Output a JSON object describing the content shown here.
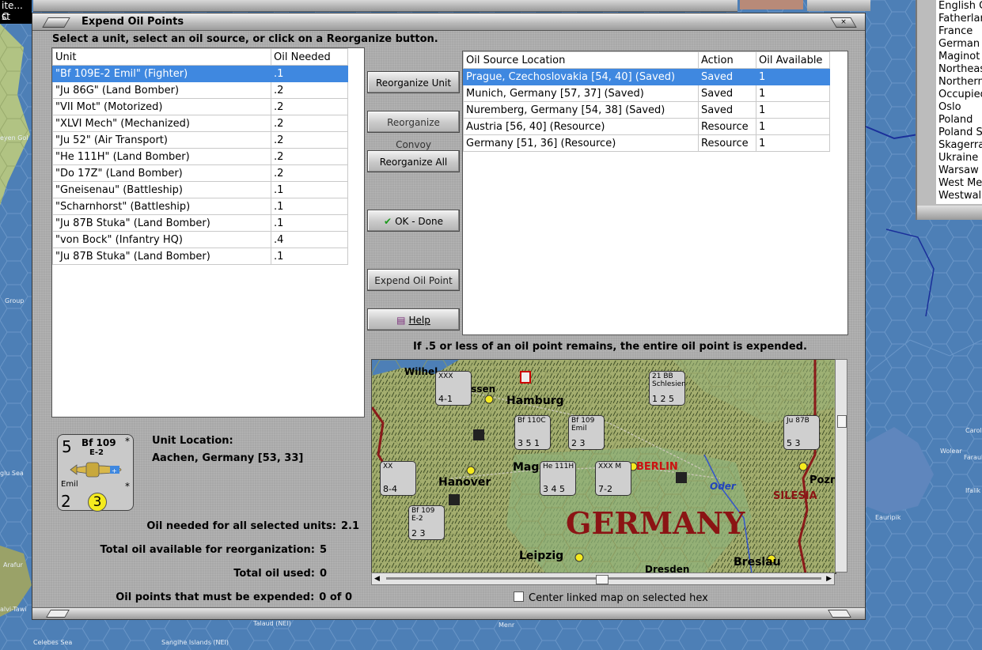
{
  "window": {
    "title": "Expend Oil Points",
    "close_glyph": "×",
    "instructions": "Select a unit, select an oil source, or click on a Reorganize button."
  },
  "units_table": {
    "columns": [
      "Unit",
      "Oil Needed"
    ],
    "rows": [
      {
        "unit": "\"Bf 109E-2 Emil\" (Fighter)",
        "oil": ".1",
        "selected": true
      },
      {
        "unit": "\"Ju 86G\" (Land Bomber)",
        "oil": ".2"
      },
      {
        "unit": "\"VII Mot\" (Motorized)",
        "oil": ".2"
      },
      {
        "unit": "\"XLVI Mech\" (Mechanized)",
        "oil": ".2"
      },
      {
        "unit": "\"Ju 52\" (Air Transport)",
        "oil": ".2"
      },
      {
        "unit": "\"He 111H\" (Land Bomber)",
        "oil": ".2"
      },
      {
        "unit": "\"Do 17Z\" (Land Bomber)",
        "oil": ".2"
      },
      {
        "unit": "\"Gneisenau\" (Battleship)",
        "oil": ".1"
      },
      {
        "unit": "\"Scharnhorst\" (Battleship)",
        "oil": ".1"
      },
      {
        "unit": "\"Ju 87B Stuka\" (Land Bomber)",
        "oil": ".1"
      },
      {
        "unit": "\"von Bock\" (Infantry HQ)",
        "oil": ".4"
      },
      {
        "unit": "\"Ju 87B Stuka\" (Land Bomber)",
        "oil": ".1"
      }
    ]
  },
  "oil_table": {
    "columns": [
      "Oil Source Location",
      "Action",
      "Oil Available"
    ],
    "rows": [
      {
        "location": "Prague, Czechoslovakia [54, 40] (Saved)",
        "action": "Saved",
        "available": "1",
        "selected": true
      },
      {
        "location": "Munich, Germany [57, 37] (Saved)",
        "action": "Saved",
        "available": "1"
      },
      {
        "location": "Nuremberg, Germany [54, 38] (Saved)",
        "action": "Saved",
        "available": "1"
      },
      {
        "location": "Austria [56, 40] (Resource)",
        "action": "Resource",
        "available": "1"
      },
      {
        "location": "Germany [51, 36] (Resource)",
        "action": "Resource",
        "available": "1"
      }
    ]
  },
  "buttons": {
    "reorganize_unit": "Reorganize Unit",
    "reorganize_convoy": "Reorganize Convoy",
    "reorganize_all": "Reorganize All",
    "ok_done": "OK - Done",
    "expend_oil_point": "Expend Oil Point",
    "help": "Help"
  },
  "icons": {
    "ok": "check-icon",
    "help": "book-icon",
    "close": "close-icon"
  },
  "expend_note": "If .5 or less of an oil point remains, the entire oil point is expended.",
  "selected_unit": {
    "attack": "5",
    "name": "Bf 109",
    "variant": "E-2",
    "nickname": "Emil",
    "defense": "2",
    "range": "3",
    "location_label": "Unit Location:",
    "location_value": "Aachen, Germany [53, 33]"
  },
  "stats": {
    "needed_label": "Oil needed for all selected units:",
    "needed_value": "2.1",
    "available_label": "Total oil available for reorganization:",
    "available_value": "5",
    "used_label": "Total oil used:",
    "used_value": "0",
    "must_expend_label": "Oil points that must be expended:",
    "must_expend_value": "0 of 0"
  },
  "center_linked_map": {
    "label": "Center linked map on selected hex",
    "checked": false
  },
  "map": {
    "labels": {
      "hamburg": "Hamburg",
      "hanover": "Hanover",
      "berlin": "BERLIN",
      "germany": "GERMANY",
      "leipzig": "Leipzig",
      "breslau": "Breslau",
      "oder": "Oder",
      "silesia": "SILESIA",
      "magd": "Magd",
      "pozn": "Pozn",
      "wilhel": "Wilhel",
      "essen": "Essen",
      "dresden": "Dresden"
    },
    "units": [
      {
        "top": "XXX",
        "bottom": "4-1"
      },
      {
        "top": "21 BB Schlesien",
        "bottom": "1 2 5"
      },
      {
        "top": "Bf 110C",
        "bottom": "3 5 1"
      },
      {
        "top": "Bf 109 Emil",
        "bottom": "2 3"
      },
      {
        "top": "Ju 87B",
        "bottom": "5 3"
      },
      {
        "top": "XX",
        "bottom": "8-4"
      },
      {
        "top": "He 111H",
        "bottom": "3 4 5"
      },
      {
        "top": "XXX M",
        "bottom": "7-2"
      },
      {
        "top": "Bf 109 E-2",
        "bottom": "2 3"
      }
    ]
  },
  "side_list": {
    "items": [
      "English C",
      "Fatherlan",
      "France",
      "German P",
      "Maginot",
      "Northeas",
      "Northern",
      "Occupied",
      "Oslo",
      "Poland",
      "Poland S",
      "Skagerra",
      "Ukraine",
      "Warsaw",
      "West Me",
      "Westwal"
    ]
  },
  "background": {
    "top_left_1": "ite... C",
    "top_left_2": "st",
    "labels": [
      "eyen Gol",
      "Group",
      "glu Sea",
      "Arafur",
      "alvi-Tawi",
      "Celebes Sea",
      "Sangihe Islands (NEI)",
      "Talaud (NEI)",
      "Menr",
      "Wolear",
      "Eauripik",
      "Faraulep",
      "Ifalik",
      "Caroli"
    ]
  },
  "colors": {
    "selection": "#3f88e0",
    "ocean": "#4d7fb6",
    "dialog": "#a8a8a8",
    "berlin": "#cc1111",
    "germany": "#8b1414"
  }
}
